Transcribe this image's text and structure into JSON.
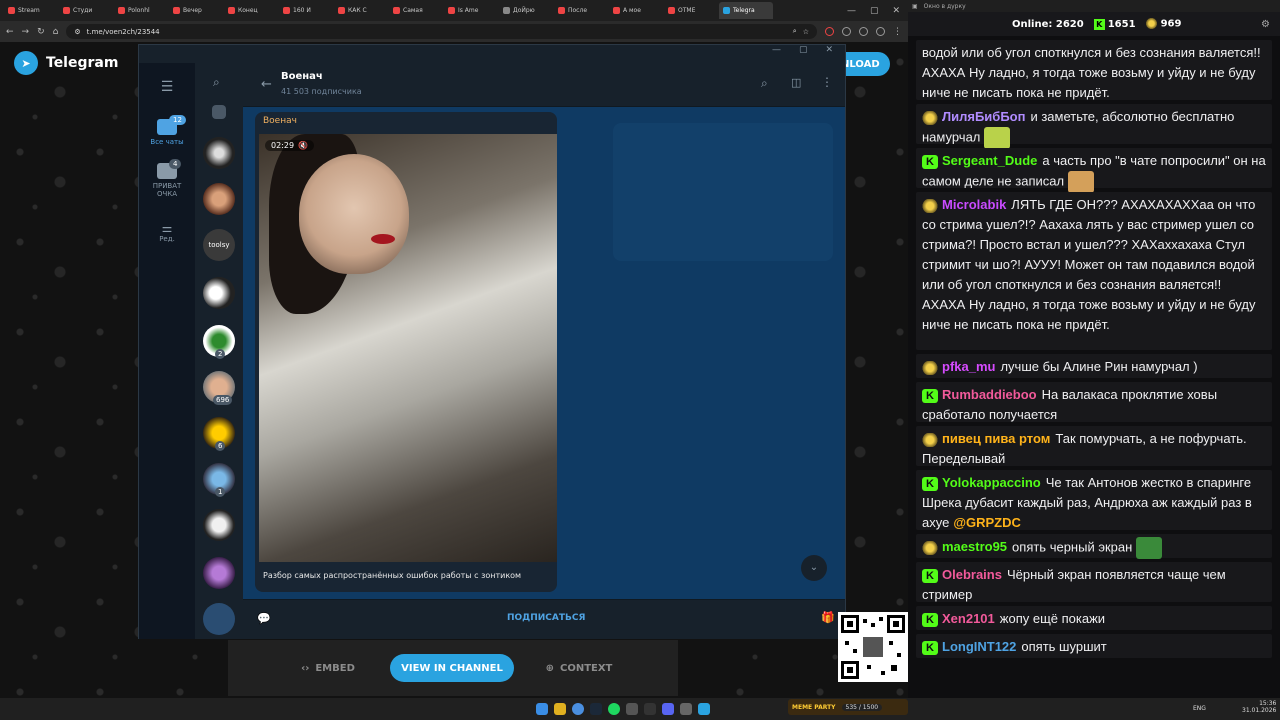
{
  "browser": {
    "tabs": [
      "Stream",
      "Студи",
      "Polonhl",
      "Вечер",
      "Конец",
      "160 И",
      "КАК С",
      "Самая",
      "Is Ame",
      "ДоЙрю",
      "После",
      "А мое",
      "ОТМЕ",
      "Telegra"
    ],
    "url": "t.me/voen2ch/23544"
  },
  "telegram_page": {
    "logo_label": "Telegram",
    "download_label": "NLOAD"
  },
  "app": {
    "sidebar": {
      "all_chats_label": "Все чаты",
      "all_chats_badge": "12",
      "private_label": "ПРИВАТ ОЧКА",
      "private_badge": "4",
      "edit_label": "Ред."
    },
    "chat_list_badges": [
      "2",
      "696",
      "6",
      "1"
    ],
    "chat_list_text": [
      "toolsy"
    ],
    "header": {
      "title": "Военач",
      "subtitle": "41 503 подписчика"
    },
    "message": {
      "author": "Военач",
      "duration": "02:29",
      "caption": "Разбор самых распространённых ошибок работы с зонтиком"
    },
    "subscribe_label": "ПОДПИСАТЬСЯ"
  },
  "embed_bar": {
    "embed_label": "EMBED",
    "view_label": "VIEW IN CHANNEL",
    "context_label": "CONTEXT"
  },
  "chat_panel": {
    "window_title": "Окно в дурку",
    "online_label": "Online:",
    "online_count": "2620",
    "kick_count": "1651",
    "other_count": "969",
    "messages": [
      {
        "user": "",
        "color": "#efeff1",
        "text": "водой или об угол споткнулся и без сознания валяется!! АХАХА Ну ладно, я тогда тоже возьму и уйду и не буду ниче не писать пока не придёт.",
        "badge": "none"
      },
      {
        "user": "ЛиляБибБоп",
        "color": "#b18cff",
        "text": "и заметьте, абсолютно бесплатно намурчал",
        "badge": "p"
      },
      {
        "user": "Sergeant_Dude",
        "color": "#53fc18",
        "text": "а часть про \"в чате попросили\" он на самом деле не записал",
        "badge": "k"
      },
      {
        "user": "Microlabik",
        "color": "#c94bff",
        "text": "ЛЯТЬ ГДЕ ОН??? АХАХАХАХХаа он что со стрима ушел?!? Аахаха лять у вас стример ушел со стрима?! Просто встал и ушел??? ХАХаххахаха Стул стримит чи шо?! АУУУ! Может он там подавился водой или об угол споткнулся и без сознания валяется!! АХАХА Ну ладно, я тогда тоже возьму и уйду и не буду ниче не писать пока не придёт.",
        "badge": "p"
      },
      {
        "user": "pfka_mu",
        "color": "#d64bff",
        "text": "лучше бы Алине Рин намурчал )",
        "badge": "p"
      },
      {
        "user": "Rumbaddieboo",
        "color": "#f25a9b",
        "text": "На валакаса проклятие ховы сработало получается",
        "badge": "k"
      },
      {
        "user": "пивец пива ртом",
        "color": "#ffb31a",
        "text": "Так помурчать, а не пофурчать. Переделывай",
        "badge": "p"
      },
      {
        "user": "Yolokappaccino",
        "color": "#53fc18",
        "text": "Че так Антонов жестко в спаринге Шрека дубасит каждый раз, Андрюха аж каждый раз в ахуе",
        "mention": "@GRPZDC",
        "badge": "k"
      },
      {
        "user": "maestro95",
        "color": "#53fc18",
        "text": "опять черный экран",
        "badge": "p"
      },
      {
        "user": "Olebrains",
        "color": "#f25a9b",
        "text": "Чёрный экран появляется чаще чем стример",
        "badge": "k"
      },
      {
        "user": "Xen2101",
        "color": "#f25a9b",
        "text": "жопу ещё покажи",
        "badge": "k"
      },
      {
        "user": "LongINT122",
        "color": "#4fa3e3",
        "text": "опять шуршит",
        "badge": "k"
      }
    ]
  },
  "taskbar": {
    "lang": "ENG",
    "time": "15:36",
    "date": "31.01.2026",
    "meme_label": "MEME PARTY",
    "meme_count": "535 / 1500"
  },
  "colors": {
    "accent": "#2aa3e0",
    "kick": "#53fc18",
    "tg_bg": "#17212b",
    "chat_bg": "#0f3a63"
  }
}
